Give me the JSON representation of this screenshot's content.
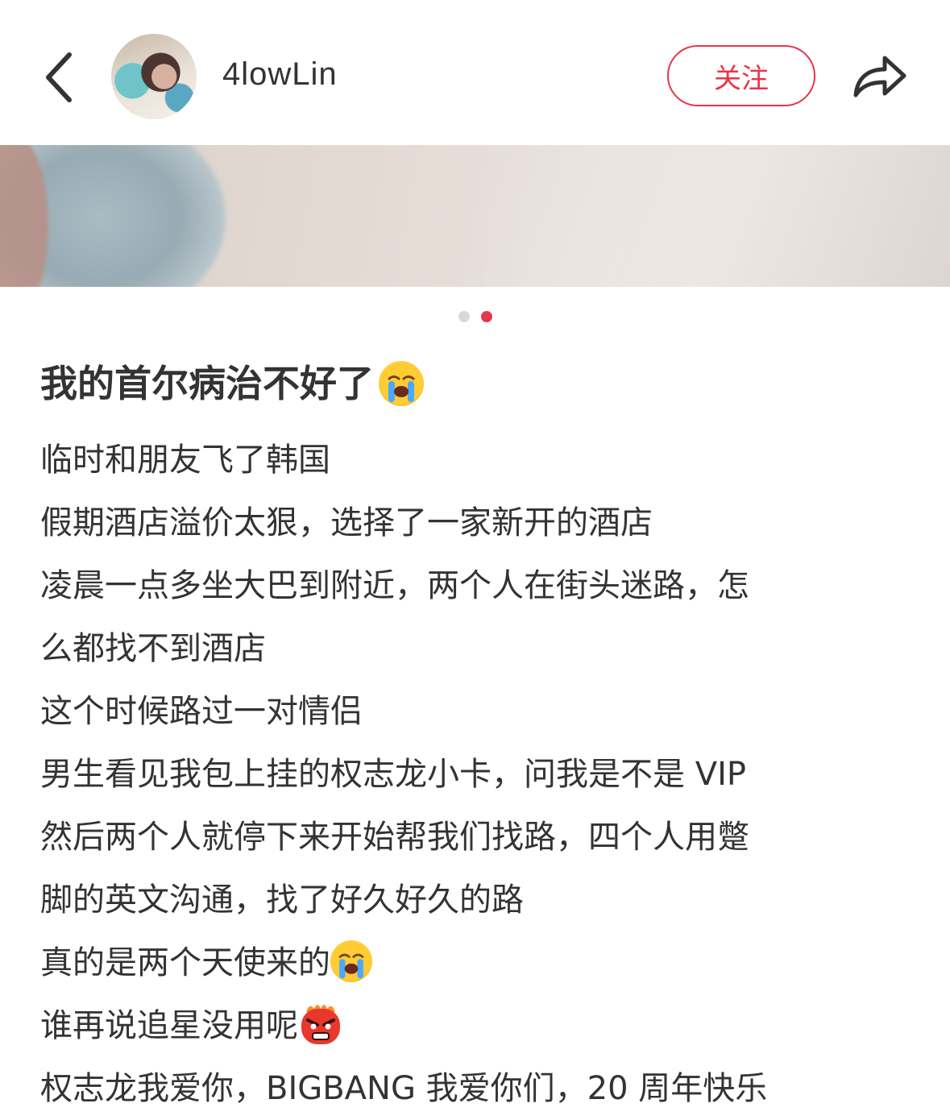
{
  "header": {
    "username": "4lowLin",
    "follow_label": "关注",
    "icons": {
      "back": "chevron-left-icon",
      "share": "share-arrow-icon"
    }
  },
  "photo": {
    "page_count": 2,
    "current_page": 2
  },
  "post": {
    "title": "我的首尔病治不好了",
    "title_emoji": "loudly-crying-face",
    "lines": [
      "临时和朋友飞了韩国",
      "假期酒店溢价太狠，选择了一家新开的酒店",
      "凌晨一点多坐大巴到附近，两个人在街头迷路，怎",
      "么都找不到酒店",
      "这个时候路过一对情侣",
      "男生看见我包上挂的权志龙小卡，问我是不是 VIP",
      "然后两个人就停下来开始帮我们找路，四个人用蹩",
      "脚的英文沟通，找了好久好久的路",
      "真的是两个天使来的",
      "谁再说追星没用呢",
      "权志龙我爱你，BIGBANG 我爱你们，20 周年快乐"
    ],
    "line_emojis": {
      "8": "loudly-crying-face",
      "9": "angry-face-emoji"
    }
  },
  "colors": {
    "accent": "#e6364a",
    "text": "#333333",
    "dot_inactive": "#d8d8d8"
  }
}
